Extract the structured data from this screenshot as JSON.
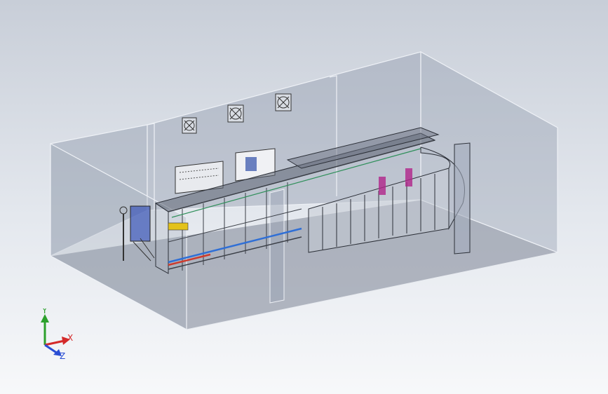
{
  "colors": {
    "background_top": "#c8ced8",
    "background_bottom": "#f7f8fa",
    "wall_fill": "#8f98ab",
    "wall_edge": "#eef1f6",
    "floor_fill": "#7c8394",
    "machine_frame": "#3b3f47",
    "conveyor_blue": "#2f6fd6",
    "conveyor_red": "#cc3b2e",
    "accent_yellow": "#e3c21b",
    "accent_magenta": "#b0248a",
    "axis_x": "#d42a2a",
    "axis_y": "#2ca02c",
    "axis_z": "#2a4ed4"
  },
  "triad": {
    "x_label": "X",
    "y_label": "Y",
    "z_label": "Z"
  },
  "icons": {
    "fan": "exhaust-fan-icon",
    "triad": "axis-triad-icon"
  }
}
